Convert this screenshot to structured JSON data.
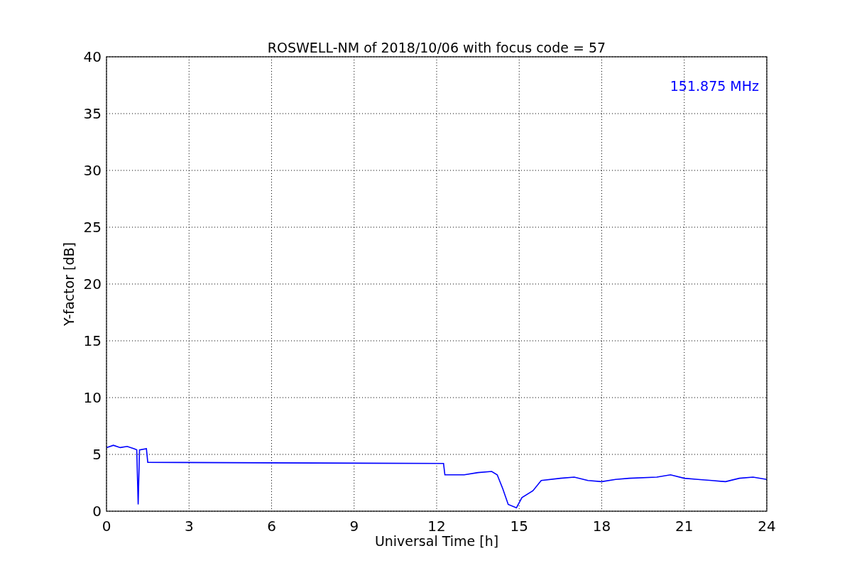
{
  "chart_data": {
    "type": "line",
    "title": "ROSWELL-NM of 2018/10/06 with focus code = 57",
    "xlabel": "Universal Time [h]",
    "ylabel": "Y-factor [dB]",
    "x": [
      0,
      0.25,
      0.5,
      0.75,
      1.0,
      1.1,
      1.15,
      1.2,
      1.45,
      1.5,
      12.25,
      12.3,
      13,
      13.5,
      14,
      14.2,
      14.4,
      14.6,
      14.9,
      15.1,
      15.5,
      15.8,
      16.5,
      17,
      17.5,
      18,
      18.5,
      19,
      20,
      20.5,
      21,
      21.5,
      22,
      22.5,
      23,
      23.5,
      24
    ],
    "series": [
      {
        "name": "151.875 MHz",
        "color": "#0000ff",
        "values": [
          5.6,
          5.8,
          5.6,
          5.7,
          5.5,
          5.4,
          0.6,
          5.4,
          5.5,
          4.3,
          4.2,
          3.2,
          3.2,
          3.4,
          3.5,
          3.2,
          2.0,
          0.6,
          0.3,
          1.2,
          1.8,
          2.7,
          2.9,
          3.0,
          2.7,
          2.6,
          2.8,
          2.9,
          3.0,
          3.2,
          2.9,
          2.8,
          2.7,
          2.6,
          2.9,
          3.0,
          2.8
        ]
      }
    ],
    "xlim": [
      0,
      24
    ],
    "ylim": [
      0,
      40
    ],
    "xticks": [
      0,
      3,
      6,
      9,
      12,
      15,
      18,
      21,
      24
    ],
    "yticks": [
      0,
      5,
      10,
      15,
      20,
      25,
      30,
      35,
      40
    ],
    "grid": true
  }
}
